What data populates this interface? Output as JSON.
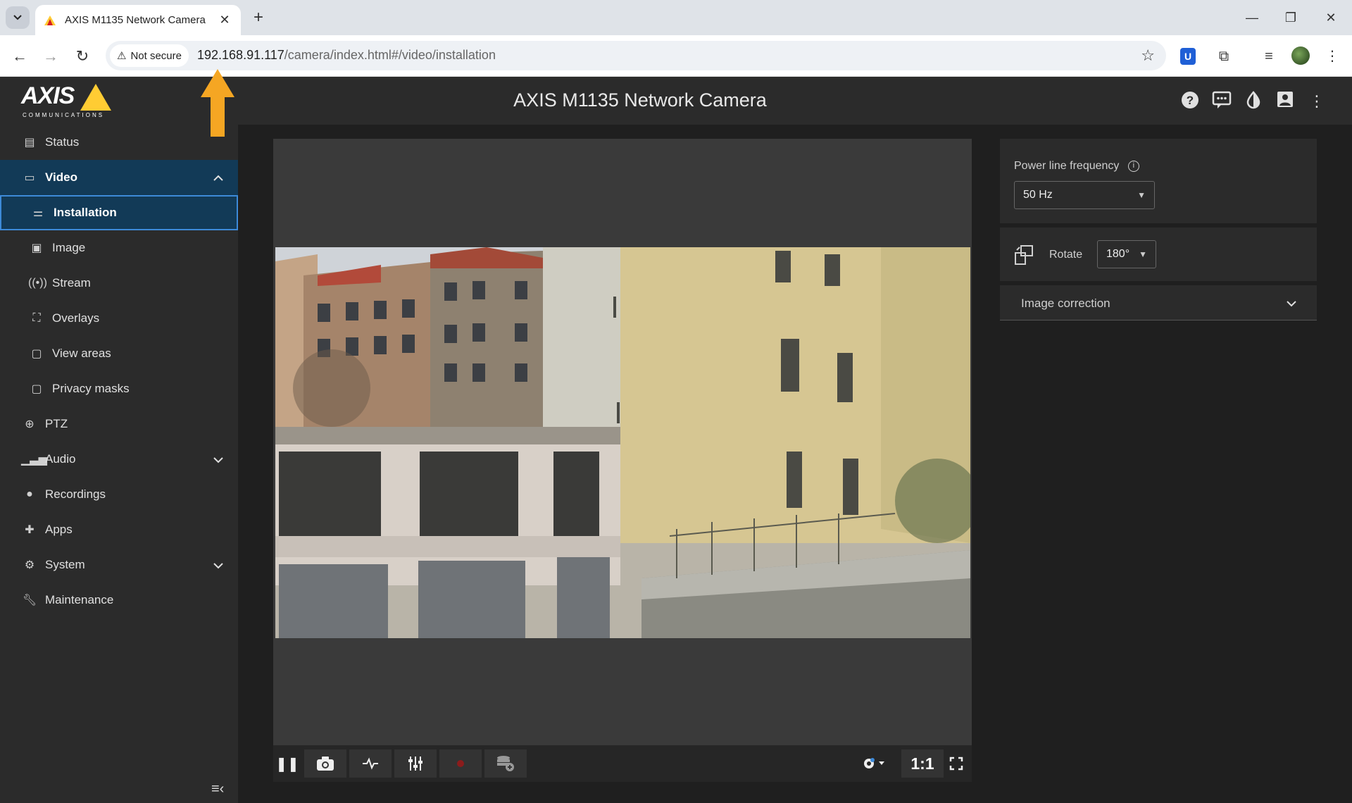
{
  "browser": {
    "tab_title": "AXIS M1135 Network Camera",
    "security_label": "Not secure",
    "url_host": "192.168.91.117",
    "url_path": "/camera/index.html#/video/installation"
  },
  "header": {
    "logo_text": "AXIS",
    "logo_sub": "COMMUNICATIONS",
    "title": "AXIS M1135 Network Camera"
  },
  "sidebar": {
    "items": [
      {
        "label": "Status",
        "icon": "status-icon"
      },
      {
        "label": "Video",
        "icon": "video-icon"
      },
      {
        "label": "Installation",
        "icon": "sliders-icon"
      },
      {
        "label": "Image",
        "icon": "image-icon"
      },
      {
        "label": "Stream",
        "icon": "stream-icon"
      },
      {
        "label": "Overlays",
        "icon": "overlays-icon"
      },
      {
        "label": "View areas",
        "icon": "view-areas-icon"
      },
      {
        "label": "Privacy masks",
        "icon": "privacy-mask-icon"
      },
      {
        "label": "PTZ",
        "icon": "ptz-icon"
      },
      {
        "label": "Audio",
        "icon": "audio-icon"
      },
      {
        "label": "Recordings",
        "icon": "recordings-icon"
      },
      {
        "label": "Apps",
        "icon": "apps-icon"
      },
      {
        "label": "System",
        "icon": "system-icon"
      },
      {
        "label": "Maintenance",
        "icon": "wrench-icon"
      }
    ]
  },
  "settings": {
    "power_line_label": "Power line frequency",
    "power_line_value": "50 Hz",
    "rotate_label": "Rotate",
    "rotate_value": "180°",
    "image_correction_label": "Image correction"
  },
  "video_toolbar": {
    "ratio_label": "1:1"
  },
  "colors": {
    "accent": "#3d8ad8",
    "active_bg": "#123a57",
    "annotation_arrow": "#f5a623",
    "logo_yellow": "#ffcc33"
  }
}
